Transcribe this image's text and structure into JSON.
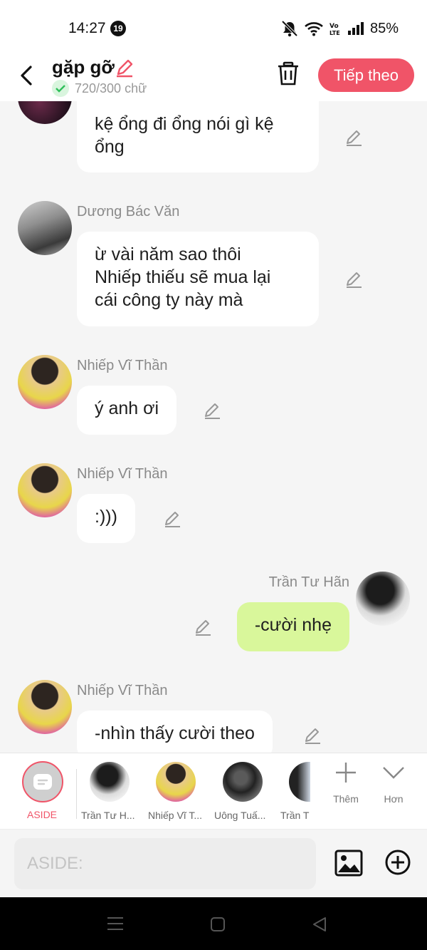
{
  "status": {
    "time": "14:27",
    "notif_count": "19",
    "battery": "85%"
  },
  "header": {
    "title": "gặp gỡ",
    "char_count": "720/300 chữ",
    "next_label": "Tiếp theo"
  },
  "messages": [
    {
      "name": "",
      "text": "kệ ổng đi ổng nói gì kệ\nổng"
    },
    {
      "name": "Dương Bác Văn",
      "text": "ừ vài năm sao thôi\nNhiếp thiếu sẽ mua lại\ncái công ty này mà"
    },
    {
      "name": "Nhiếp Vĩ Thần",
      "text": "ý anh ơi"
    },
    {
      "name": "Nhiếp Vĩ Thần",
      "text": ":)))"
    },
    {
      "name": "Trần Tư Hãn",
      "text": "-cười nhẹ"
    },
    {
      "name": "Nhiếp Vĩ Thần",
      "text": "-nhìn thấy cười theo"
    }
  ],
  "characters": {
    "aside_label": "ASIDE",
    "items": [
      {
        "label": "Trần Tư H..."
      },
      {
        "label": "Nhiếp Vĩ T..."
      },
      {
        "label": "Uông Tuấ..."
      },
      {
        "label": "Trần T"
      }
    ],
    "add_label": "Thêm",
    "more_label": "Hơn"
  },
  "input": {
    "placeholder": "ASIDE:"
  },
  "colors": {
    "accent": "#f05468",
    "my_bubble": "#d9f79b",
    "bubble": "#ffffff"
  }
}
